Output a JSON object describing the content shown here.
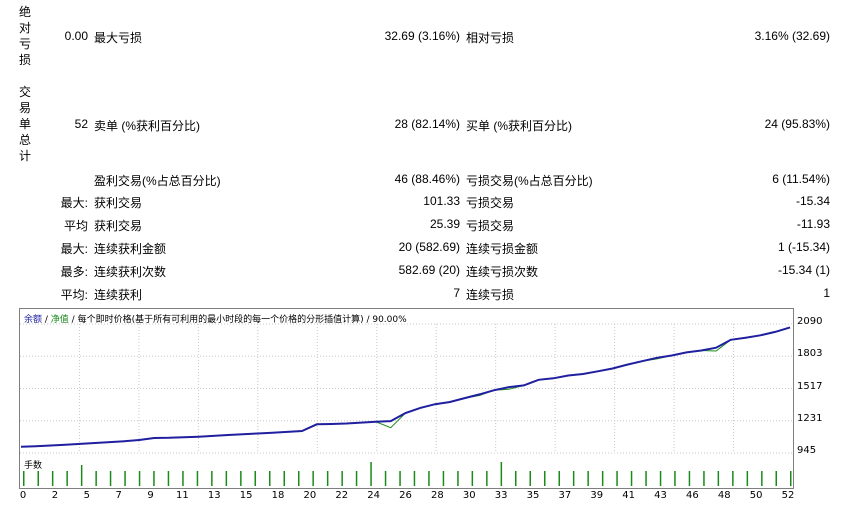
{
  "side_labels": {
    "absolute": [
      "绝",
      "对",
      "亏",
      "损"
    ],
    "trades_total": [
      "交",
      "易",
      "单",
      "总",
      "计"
    ]
  },
  "rows": {
    "drawdown": {
      "abs_value": "0.00",
      "max_label": "最大亏损",
      "max_value": "32.69 (3.16%)",
      "rel_label": "相对亏损",
      "rel_value": "3.16% (32.69)"
    },
    "trades": {
      "total": "52",
      "short_label": "卖单 (%获利百分比)",
      "short_value": "28 (82.14%)",
      "long_label": "买单 (%获利百分比)",
      "long_value": "24 (95.83%)"
    },
    "profit_trades": {
      "label": "盈利交易(%占总百分比)",
      "value": "46 (88.46%)",
      "loss_label": "亏损交易(%占总百分比)",
      "loss_value": "6 (11.54%)"
    },
    "largest": {
      "prefix": "最大:",
      "label": "获利交易",
      "value": "101.33",
      "loss_label": "亏损交易",
      "loss_value": "-15.34"
    },
    "average": {
      "prefix": "平均",
      "label": "获利交易",
      "value": "25.39",
      "loss_label": "亏损交易",
      "loss_value": "-11.93"
    },
    "max_consec_amount": {
      "prefix": "最大:",
      "label": "连续获利金额",
      "value": "20 (582.69)",
      "loss_label": "连续亏损金额",
      "loss_value": "1 (-15.34)"
    },
    "max_consec_count": {
      "prefix": "最多:",
      "label": "连续获利次数",
      "value": "582.69 (20)",
      "loss_label": "连续亏损次数",
      "loss_value": "-15.34 (1)"
    },
    "avg_consec": {
      "prefix": "平均:",
      "label": "连续获利",
      "value": "7",
      "loss_label": "连续亏损",
      "loss_value": "1"
    }
  },
  "chart_legend": {
    "balance": "余额",
    "sep1": " / ",
    "equity": "净值",
    "sep2": " / ",
    "model": "每个即时价格(基于所有可利用的最小时段的每一个价格的分形插值计算)",
    "sep3": " / ",
    "quality": "90.00%"
  },
  "volume_title": "手数",
  "colors": {
    "balance": "#1f1f9f",
    "equity": "#1a8a1a",
    "volume": "#1a8a1a",
    "grid": "#c8c8c8"
  },
  "chart_data": {
    "type": "line",
    "ylim": [
      945,
      2090
    ],
    "yticks": [
      "2090",
      "1803",
      "1517",
      "1231",
      "945"
    ],
    "xticks": [
      "0",
      "2",
      "5",
      "7",
      "9",
      "11",
      "13",
      "15",
      "18",
      "20",
      "22",
      "24",
      "26",
      "28",
      "30",
      "33",
      "35",
      "37",
      "39",
      "41",
      "43",
      "46",
      "48",
      "50",
      "52"
    ],
    "series": [
      {
        "key": "balance",
        "values": [
          1000,
          1005,
          1012,
          1018,
          1026,
          1034,
          1042,
          1050,
          1060,
          1078,
          1080,
          1085,
          1090,
          1097,
          1105,
          1112,
          1118,
          1125,
          1132,
          1140,
          1200,
          1202,
          1207,
          1215,
          1222,
          1228,
          1300,
          1345,
          1378,
          1398,
          1432,
          1465,
          1502,
          1530,
          1545,
          1595,
          1608,
          1633,
          1646,
          1670,
          1695,
          1730,
          1760,
          1790,
          1810,
          1838,
          1855,
          1880,
          1950,
          1968,
          1990,
          2020,
          2060
        ]
      },
      {
        "key": "equity",
        "values": [
          1000,
          1005,
          1012,
          1018,
          1026,
          1034,
          1042,
          1050,
          1060,
          1078,
          1080,
          1085,
          1090,
          1097,
          1105,
          1112,
          1118,
          1125,
          1132,
          1140,
          1200,
          1202,
          1207,
          1215,
          1222,
          1170,
          1300,
          1345,
          1378,
          1398,
          1432,
          1455,
          1502,
          1510,
          1545,
          1595,
          1608,
          1633,
          1646,
          1670,
          1695,
          1730,
          1760,
          1780,
          1810,
          1838,
          1855,
          1850,
          1950,
          1968,
          1990,
          2020,
          2060
        ]
      }
    ],
    "volume": {
      "values": [
        1,
        1,
        1,
        1,
        1.4,
        1,
        1,
        1,
        1,
        1,
        1,
        1,
        1,
        1,
        1,
        1,
        1,
        1,
        1,
        1,
        1,
        1,
        1,
        1,
        1.6,
        1,
        1,
        1,
        1,
        1,
        1,
        1,
        1,
        1.6,
        1,
        1,
        1,
        1,
        1,
        1,
        1,
        1,
        1,
        1,
        1,
        1,
        1,
        1,
        1,
        1,
        1,
        1,
        1,
        1
      ]
    }
  }
}
